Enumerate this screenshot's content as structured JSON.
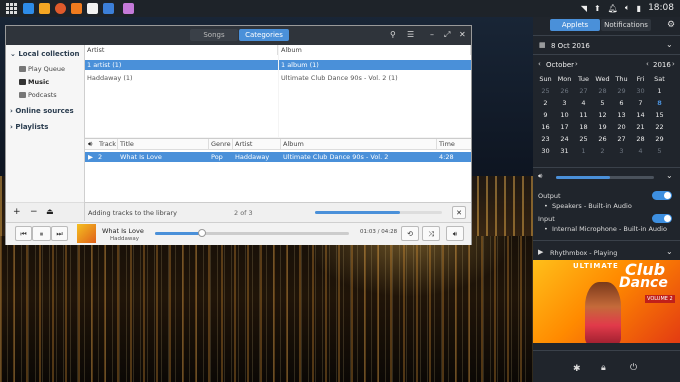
{
  "topbar": {
    "time": "18:08",
    "launcher_icons": [
      "apps-grid-icon",
      "downloader-icon",
      "store-icon",
      "media-icon",
      "player-icon",
      "music-icon",
      "files-icon",
      "window-icon"
    ]
  },
  "window": {
    "tabs": [
      "Songs",
      "Categories"
    ],
    "active_tab": "Categories",
    "sidebar": {
      "local_collection": "Local collection",
      "play_queue": "Play Queue",
      "music": "Music",
      "podcasts": "Podcasts",
      "online_sources": "Online sources",
      "playlists": "Playlists"
    },
    "artist_pane": {
      "header": "Artist",
      "selected": "1 artist (1)",
      "rows": [
        "Haddaway (1)"
      ]
    },
    "album_pane": {
      "header": "Album",
      "selected": "1 album (1)",
      "rows": [
        "Ultimate Club Dance 90s - Vol. 2 (1)"
      ]
    },
    "tracklist": {
      "headers": {
        "track": "Track",
        "title": "Title",
        "genre": "Genre",
        "artist": "Artist",
        "album": "Album",
        "time": "Time"
      },
      "row": {
        "track": "2",
        "title": "What Is Love",
        "genre": "Pop",
        "artist": "Haddaway",
        "album": "Ultimate Club Dance 90s - Vol. 2",
        "time": "4:28"
      }
    },
    "status": {
      "message": "Adding tracks to the library",
      "count": "2 of 3",
      "progress": 0.67
    },
    "sidebar_buttons": [
      "+",
      "−",
      "⏏"
    ],
    "player": {
      "title": "What Is Love",
      "artist": "Haddaway",
      "position": "01:03",
      "duration": "04:28",
      "progress": 0.24
    }
  },
  "right_panel": {
    "tabs": [
      "Applets",
      "Notifications"
    ],
    "active_tab": "Applets",
    "date": "8 Oct 2016",
    "calendar": {
      "month": "October",
      "year": "2016",
      "weekdays": [
        "Sun",
        "Mon",
        "Tue",
        "Wed",
        "Thu",
        "Fri",
        "Sat"
      ],
      "weeks": [
        [
          "25",
          "26",
          "27",
          "28",
          "29",
          "30",
          "1"
        ],
        [
          "2",
          "3",
          "4",
          "5",
          "6",
          "7",
          "8"
        ],
        [
          "9",
          "10",
          "11",
          "12",
          "13",
          "14",
          "15"
        ],
        [
          "16",
          "17",
          "18",
          "19",
          "20",
          "21",
          "22"
        ],
        [
          "23",
          "24",
          "25",
          "26",
          "27",
          "28",
          "29"
        ],
        [
          "30",
          "31",
          "1",
          "2",
          "3",
          "4",
          "5"
        ]
      ],
      "today": "8"
    },
    "volume_level": 0.55,
    "output_label": "Output",
    "output_device": "Speakers - Built-in Audio",
    "input_label": "Input",
    "input_device": "Internal Microphone - Built-in Audio",
    "media_status": "Rhythmbox - Playing",
    "album_art_text": {
      "line1": "ULTIMATE",
      "line2": "Club",
      "line3": "Dance",
      "badge": "VOLUME 2"
    }
  },
  "colors": {
    "accent": "#4a90d9",
    "panel_bg": "#20252c",
    "window_header": "#2f343b"
  }
}
